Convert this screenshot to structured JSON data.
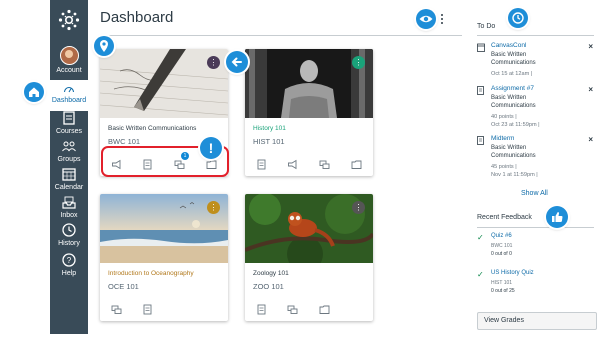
{
  "sidebar": {
    "items": [
      {
        "label": "Account",
        "icon": "avatar"
      },
      {
        "label": "Dashboard",
        "icon": "dashboard-icon"
      },
      {
        "label": "Courses",
        "icon": "courses-icon"
      },
      {
        "label": "Groups",
        "icon": "groups-icon"
      },
      {
        "label": "Calendar",
        "icon": "calendar-icon"
      },
      {
        "label": "Inbox",
        "icon": "inbox-icon"
      },
      {
        "label": "History",
        "icon": "history-icon"
      },
      {
        "label": "Help",
        "icon": "help-icon"
      }
    ]
  },
  "header": {
    "title": "Dashboard"
  },
  "cards": [
    {
      "name": "Basic Written Communications",
      "code": "BWC 101",
      "color": "#4b3b58",
      "name_color": "#2d3b45",
      "notification_count": "1"
    },
    {
      "name": "History 101",
      "code": "HIST 101",
      "color": "#1aa37a",
      "name_color": "#1aa37a"
    },
    {
      "name": "Introduction to Oceanography",
      "code": "OCE 101",
      "color": "#bf8f1c",
      "name_color": "#b1781b"
    },
    {
      "name": "Zoology 101",
      "code": "ZOO 101",
      "color": "#555555",
      "name_color": "#2d3b45"
    }
  ],
  "todo": {
    "title": "To Do",
    "items": [
      {
        "title": "CanvasConl",
        "course": "Basic Written Communications",
        "meta": [
          "Oct 15 at 12am  |"
        ]
      },
      {
        "title": "Assignment #7",
        "course": "Basic Written Communications",
        "meta": [
          "40 points  |",
          "Oct 23 at 11:59pm  |"
        ]
      },
      {
        "title": "Midterm",
        "course": "Basic Written Communications",
        "meta": [
          "45 points  |",
          "Nov 1 at 11:59pm  |"
        ]
      }
    ],
    "show_all": "Show All",
    "close_glyph": "×"
  },
  "feedback": {
    "title": "Recent Feedback",
    "items": [
      {
        "title": "Quiz #6",
        "course": "BWC 101",
        "score": "0 out of 0"
      },
      {
        "title": "US History Quiz",
        "course": "HIST 101",
        "score": "0 out of 25"
      }
    ],
    "view_grades": "View Grades"
  },
  "callouts": {
    "alert_glyph": "!"
  },
  "colors": {
    "sidebar": "#394b58",
    "link": "#0e6ba8",
    "callout": "#1e8ed8"
  }
}
